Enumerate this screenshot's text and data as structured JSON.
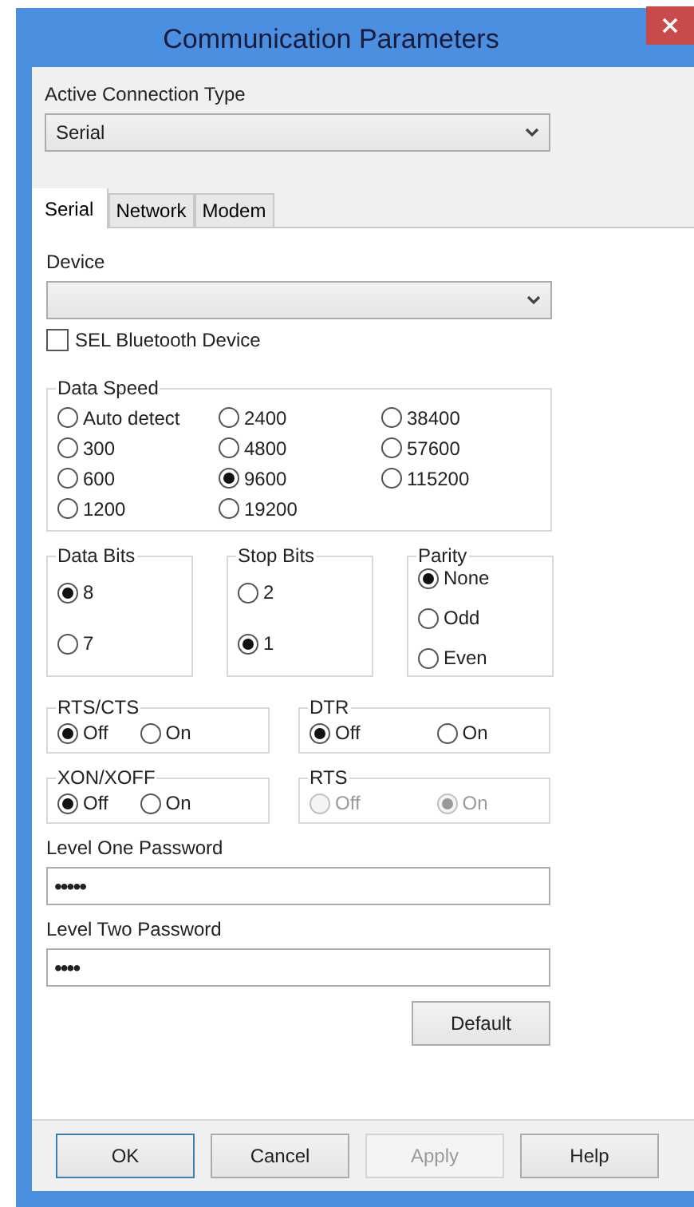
{
  "window": {
    "title": "Communication Parameters"
  },
  "connection_type": {
    "label": "Active Connection Type",
    "value": "Serial"
  },
  "tabs": [
    {
      "label": "Serial",
      "selected": true
    },
    {
      "label": "Network",
      "selected": false
    },
    {
      "label": "Modem",
      "selected": false
    }
  ],
  "device": {
    "label": "Device"
  },
  "bluetooth": {
    "label": "SEL Bluetooth Device",
    "checked": false
  },
  "data_speed": {
    "title": "Data Speed",
    "options": [
      {
        "label": "Auto detect",
        "selected": false
      },
      {
        "label": "300",
        "selected": false
      },
      {
        "label": "600",
        "selected": false
      },
      {
        "label": "1200",
        "selected": false
      },
      {
        "label": "2400",
        "selected": false
      },
      {
        "label": "4800",
        "selected": false
      },
      {
        "label": "9600",
        "selected": true
      },
      {
        "label": "19200",
        "selected": false
      },
      {
        "label": "38400",
        "selected": false
      },
      {
        "label": "57600",
        "selected": false
      },
      {
        "label": "115200",
        "selected": false
      }
    ]
  },
  "bit_groups": [
    {
      "title": "Data Bits",
      "options": [
        {
          "label": "8",
          "selected": true
        },
        {
          "label": "7",
          "selected": false
        }
      ]
    },
    {
      "title": "Stop Bits",
      "options": [
        {
          "label": "2",
          "selected": false
        },
        {
          "label": "1",
          "selected": true
        }
      ]
    },
    {
      "title": "Parity",
      "options": [
        {
          "label": "None",
          "selected": true
        },
        {
          "label": "Odd",
          "selected": false
        },
        {
          "label": "Even",
          "selected": false
        }
      ]
    }
  ],
  "flow_groups": [
    {
      "title": "RTS/CTS",
      "disabled": false,
      "options": [
        {
          "label": "Off",
          "selected": true
        },
        {
          "label": "On",
          "selected": false
        }
      ]
    },
    {
      "title": "DTR",
      "disabled": false,
      "options": [
        {
          "label": "Off",
          "selected": true
        },
        {
          "label": "On",
          "selected": false
        }
      ]
    },
    {
      "title": "XON/XOFF",
      "disabled": false,
      "options": [
        {
          "label": "Off",
          "selected": true
        },
        {
          "label": "On",
          "selected": false
        }
      ]
    },
    {
      "title": "RTS",
      "disabled": true,
      "options": [
        {
          "label": "Off",
          "selected": false
        },
        {
          "label": "On",
          "selected": true
        }
      ]
    }
  ],
  "passwords": [
    {
      "label": "Level One Password",
      "value": "•••••"
    },
    {
      "label": "Level Two Password",
      "value": "••••"
    }
  ],
  "default_button": {
    "label": "Default"
  },
  "buttons": [
    {
      "label": "OK",
      "disabled": false,
      "default": true
    },
    {
      "label": "Cancel",
      "disabled": false,
      "default": false
    },
    {
      "label": "Apply",
      "disabled": true,
      "default": false
    },
    {
      "label": "Help",
      "disabled": false,
      "default": false
    }
  ]
}
